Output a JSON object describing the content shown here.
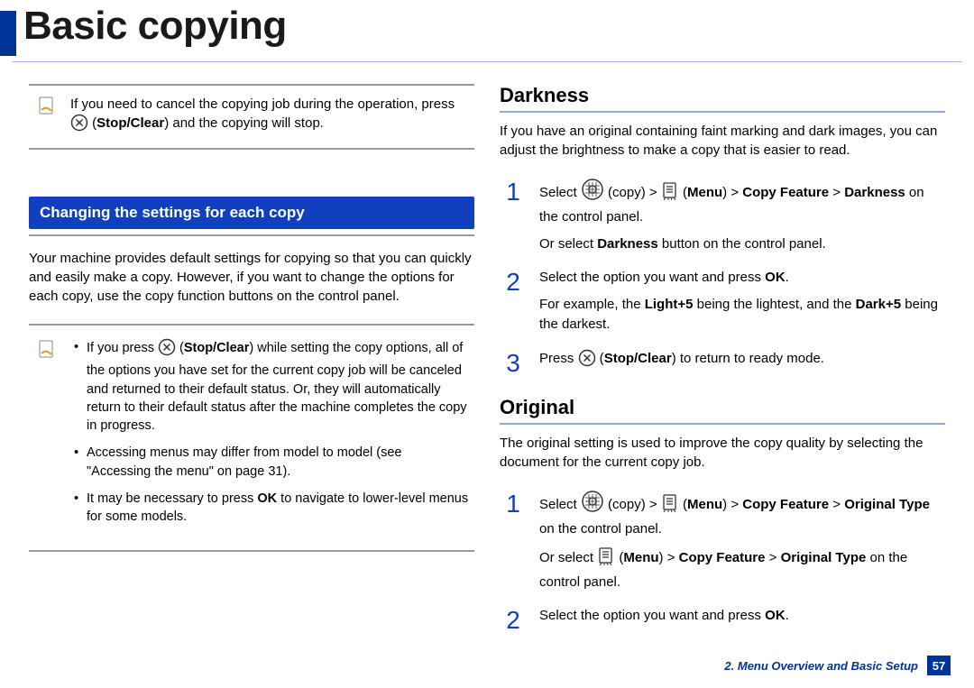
{
  "header": {
    "title": "Basic copying"
  },
  "left": {
    "note1": {
      "text_before": "If you need to cancel the copying job during the operation, press ",
      "stop_clear_label": "Stop/Clear",
      "text_after": ") and the copying will stop."
    },
    "banner": "Changing the settings for each copy",
    "intro": "Your machine provides default settings for copying so that you can quickly and easily make a copy. However, if you want to change the options for each copy, use the copy function buttons on the control panel.",
    "note2": {
      "b1_pre": "If you press ",
      "b1_label": "Stop/Clear",
      "b1_post": ") while setting the copy options, all of the options you have set for the current copy job will be canceled and returned to their default status. Or, they will automatically return to their default status after the machine completes the copy in progress.",
      "b2": "Accessing menus may differ from model to model (see \"Accessing the menu\" on page 31).",
      "b3_pre": "It may be necessary to press ",
      "b3_ok": "OK",
      "b3_post": " to navigate to lower-level menus for some models."
    }
  },
  "right": {
    "darkness": {
      "heading": "Darkness",
      "intro": "If you have an original containing faint marking and dark images, you can adjust the brightness to make a copy that is easier to read.",
      "steps": [
        {
          "num": "1",
          "p1_pre": "Select ",
          "p1_copy": "(copy) > ",
          "p1_menu": "Menu",
          "p1_mid": ") > ",
          "p1_cf": "Copy Feature",
          "p1_gt": " > ",
          "p1_dk": "Darkness",
          "p1_post": " on the control panel.",
          "p2_pre": "Or select ",
          "p2_dk": "Darkness",
          "p2_post": " button on the control panel."
        },
        {
          "num": "2",
          "p1_pre": "Select the option you want and press ",
          "p1_ok": "OK",
          "p1_post": ".",
          "p2_pre": "For example, the ",
          "p2_light": "Light+5",
          "p2_mid": " being the lightest, and the ",
          "p2_dark": "Dark+5",
          "p2_post": " being the darkest."
        },
        {
          "num": "3",
          "p1_pre": "Press ",
          "p1_label": "Stop/Clear",
          "p1_post": ") to return to ready mode."
        }
      ]
    },
    "original": {
      "heading": "Original",
      "intro": "The original setting is used to improve the copy quality by selecting the document for the current copy job.",
      "steps": [
        {
          "num": "1",
          "p1_pre": "Select ",
          "p1_copy": "(copy) > ",
          "p1_menu": "Menu",
          "p1_mid": ") > ",
          "p1_cf": "Copy Feature",
          "p1_gt": " > ",
          "p1_ot": "Original Type",
          "p1_post": " on the control panel.",
          "p2_pre": "Or select ",
          "p2_menu": "Menu",
          "p2_mid": ") > ",
          "p2_cf": "Copy Feature",
          "p2_gt": " > ",
          "p2_ot": "Original Type",
          "p2_post": " on the control panel."
        },
        {
          "num": "2",
          "p1_pre": "Select the option you want and press ",
          "p1_ok": "OK",
          "p1_post": "."
        }
      ]
    }
  },
  "footer": {
    "chapter": "2. Menu Overview and Basic Setup",
    "page": "57"
  }
}
